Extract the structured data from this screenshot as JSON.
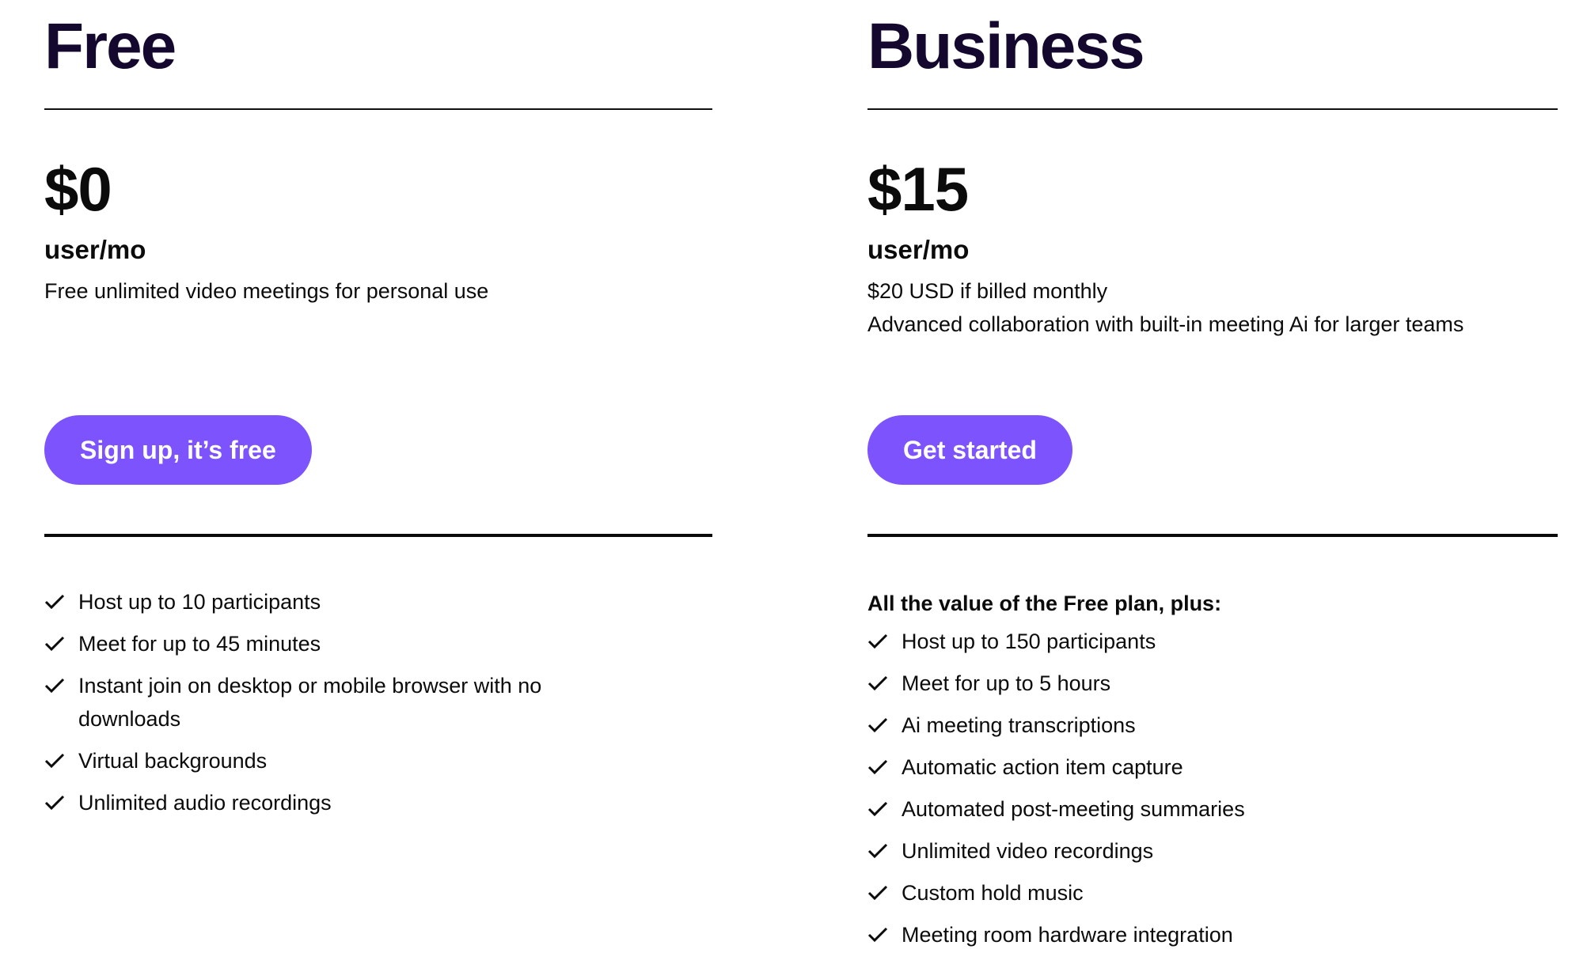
{
  "plans": [
    {
      "name": "Free",
      "price": "$0",
      "unit": "user/mo",
      "descriptions": [
        "Free unlimited video meetings for personal use"
      ],
      "cta_label": "Sign up, it’s free",
      "features_lead": "",
      "features": [
        "Host up to 10 participants",
        "Meet for up to 45 minutes",
        "Instant join on desktop or mobile browser with no downloads",
        "Virtual backgrounds",
        "Unlimited audio recordings"
      ]
    },
    {
      "name": "Business",
      "price": "$15",
      "unit": "user/mo",
      "descriptions": [
        "$20 USD if billed monthly",
        "Advanced collaboration with built-in meeting Ai for larger teams"
      ],
      "cta_label": "Get started",
      "features_lead": "All the value of the Free plan, plus:",
      "features": [
        "Host up to 150 participants",
        "Meet for up to 5 hours",
        "Ai meeting transcriptions",
        "Automatic action item capture",
        "Automated post-meeting summaries",
        "Unlimited video recordings",
        "Custom hold music",
        "Meeting room hardware integration"
      ]
    }
  ],
  "colors": {
    "accent": "#7c53fc",
    "heading": "#14082e",
    "text": "#0b0b0b"
  },
  "icons": {
    "feature_bullet": "check-icon"
  }
}
